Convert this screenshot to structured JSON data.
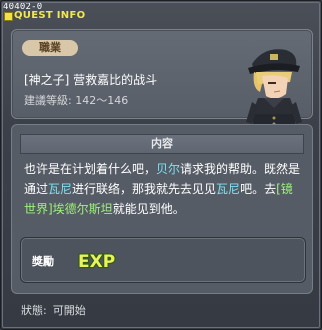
{
  "window": {
    "id_tag": "40402-0",
    "title": "QUEST INFO"
  },
  "header": {
    "job_badge": "職業",
    "quest_name": "[神之子] 营救嘉比的战斗",
    "level_range": "建議等級: 142～146"
  },
  "content": {
    "heading": "内容",
    "segments": [
      {
        "text": "也许是在计划着什么吧，",
        "style": "normal"
      },
      {
        "text": "贝尔",
        "style": "npc"
      },
      {
        "text": "请求我的帮助。既然是通过",
        "style": "normal"
      },
      {
        "text": "瓦尼",
        "style": "npc"
      },
      {
        "text": "进行联络，那我就先去见见",
        "style": "normal"
      },
      {
        "text": "瓦尼",
        "style": "npc"
      },
      {
        "text": "吧。去",
        "style": "normal"
      },
      {
        "text": "[镜世界]埃德尔斯坦",
        "style": "map"
      },
      {
        "text": "就能见到他。",
        "style": "normal"
      }
    ]
  },
  "reward": {
    "label": "獎勵",
    "item": "EXP"
  },
  "status": {
    "label": "狀態:",
    "value": "可開始"
  },
  "colors": {
    "title": "#f3e84e",
    "npc_highlight": "#7be3f3",
    "map_highlight": "#9ef27a"
  }
}
